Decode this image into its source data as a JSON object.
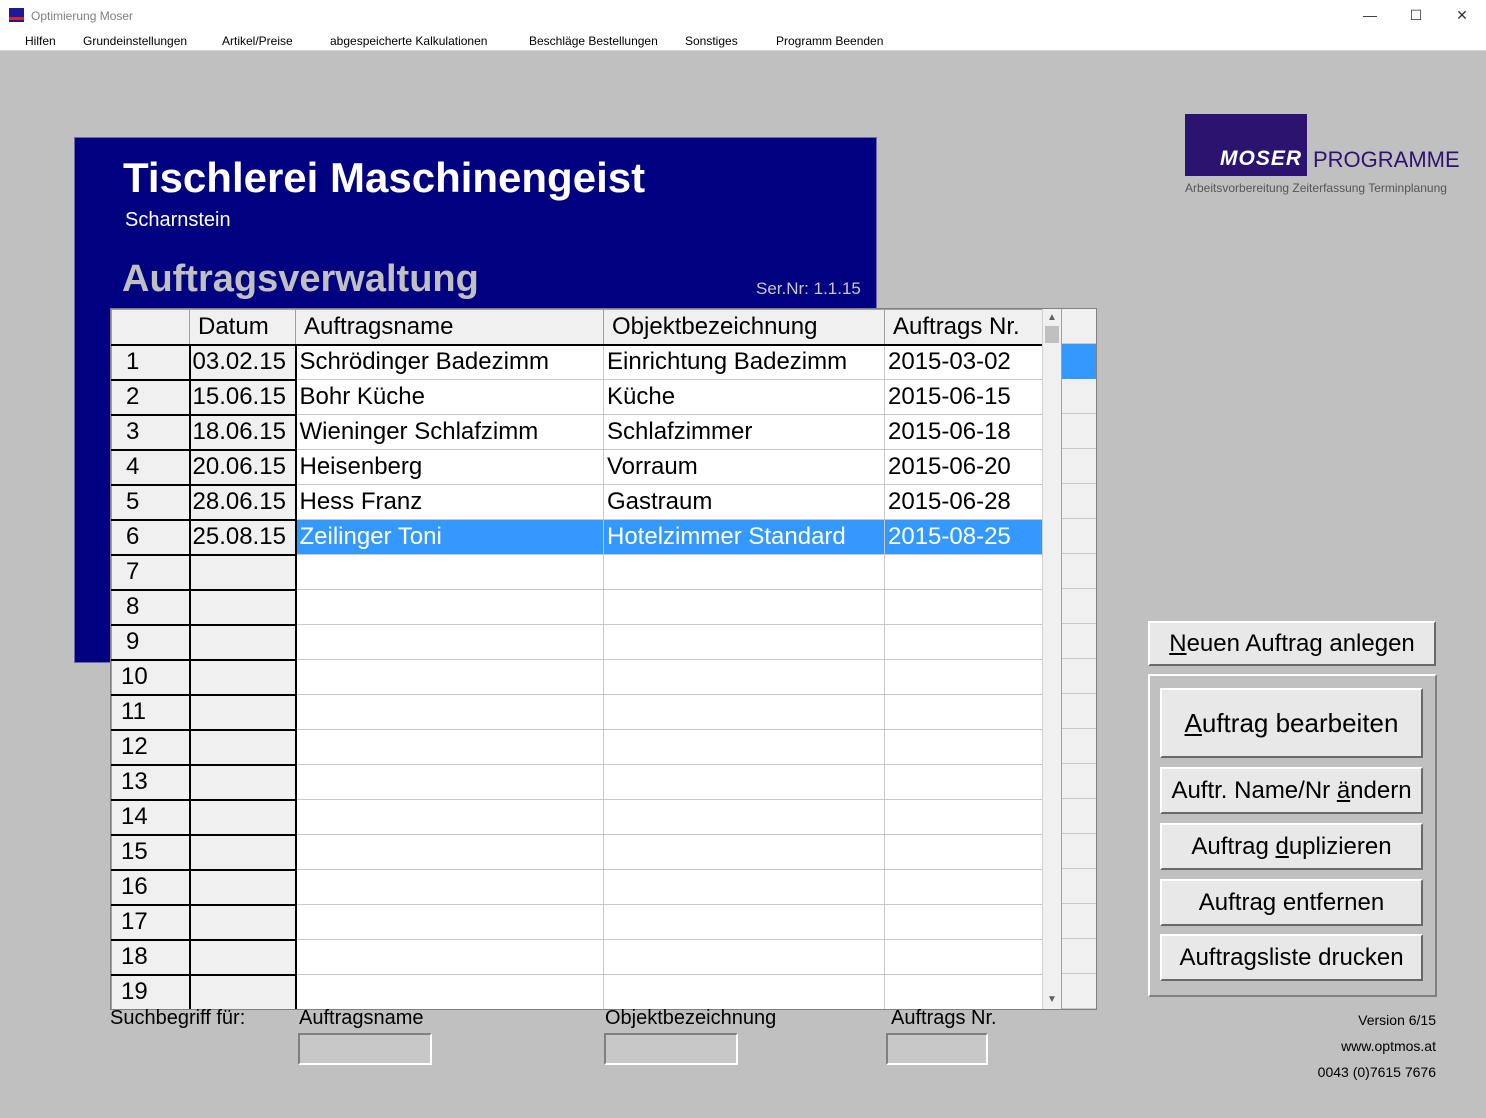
{
  "window": {
    "title": "Optimierung Moser"
  },
  "menu": [
    "Hilfen",
    "Grundeinstellungen",
    "Artikel/Preise",
    "abgespeicherte Kalkulationen",
    "Beschläge Bestellungen",
    "Sonstiges",
    "Programm Beenden"
  ],
  "header": {
    "company": "Tischlerei Maschinengeist",
    "city": "Scharnstein",
    "module": "Auftragsverwaltung",
    "serial": "Ser.Nr: 1.1.15"
  },
  "logo": {
    "word": "MOSER",
    "programme": "PROGRAMME",
    "tagline": "Arbeitsvorbereitung Zeiterfassung Terminplanung"
  },
  "grid": {
    "columns": [
      "",
      "Datum",
      "Auftragsname",
      "Objektbezeichnung",
      "Auftrags Nr."
    ],
    "selected_row": 6,
    "rows": [
      {
        "nr": "1",
        "datum": "03.02.15",
        "name": "Schrödinger Badezimm",
        "objekt": "Einrichtung Badezimm",
        "auftragsnr": "2015-03-02"
      },
      {
        "nr": "2",
        "datum": "15.06.15",
        "name": "Bohr Küche",
        "objekt": "Küche",
        "auftragsnr": "2015-06-15"
      },
      {
        "nr": "3",
        "datum": "18.06.15",
        "name": "Wieninger Schlafzimm",
        "objekt": "Schlafzimmer",
        "auftragsnr": "2015-06-18"
      },
      {
        "nr": "4",
        "datum": "20.06.15",
        "name": "Heisenberg",
        "objekt": "Vorraum",
        "auftragsnr": "2015-06-20"
      },
      {
        "nr": "5",
        "datum": "28.06.15",
        "name": "Hess Franz",
        "objekt": "Gastraum",
        "auftragsnr": "2015-06-28"
      },
      {
        "nr": "6",
        "datum": "25.08.15",
        "name": "Zeilinger Toni",
        "objekt": "Hotelzimmer Standard",
        "auftragsnr": "2015-08-25"
      },
      {
        "nr": "7",
        "datum": "",
        "name": "",
        "objekt": "",
        "auftragsnr": ""
      },
      {
        "nr": "8",
        "datum": "",
        "name": "",
        "objekt": "",
        "auftragsnr": ""
      },
      {
        "nr": "9",
        "datum": "",
        "name": "",
        "objekt": "",
        "auftragsnr": ""
      },
      {
        "nr": "10",
        "datum": "",
        "name": "",
        "objekt": "",
        "auftragsnr": ""
      },
      {
        "nr": "11",
        "datum": "",
        "name": "",
        "objekt": "",
        "auftragsnr": ""
      },
      {
        "nr": "12",
        "datum": "",
        "name": "",
        "objekt": "",
        "auftragsnr": ""
      },
      {
        "nr": "13",
        "datum": "",
        "name": "",
        "objekt": "",
        "auftragsnr": ""
      },
      {
        "nr": "14",
        "datum": "",
        "name": "",
        "objekt": "",
        "auftragsnr": ""
      },
      {
        "nr": "15",
        "datum": "",
        "name": "",
        "objekt": "",
        "auftragsnr": ""
      },
      {
        "nr": "16",
        "datum": "",
        "name": "",
        "objekt": "",
        "auftragsnr": ""
      },
      {
        "nr": "17",
        "datum": "",
        "name": "",
        "objekt": "",
        "auftragsnr": ""
      },
      {
        "nr": "18",
        "datum": "",
        "name": "",
        "objekt": "",
        "auftragsnr": ""
      },
      {
        "nr": "19",
        "datum": "",
        "name": "",
        "objekt": "",
        "auftragsnr": ""
      }
    ]
  },
  "buttons": {
    "neu": {
      "pre": "",
      "key": "N",
      "post": "euen Auftrag anlegen"
    },
    "bearbeiten": {
      "pre": "",
      "key": "A",
      "post": "uftrag bearbeiten"
    },
    "aendern": {
      "pre": "Auftr. Name/Nr ",
      "key": "ä",
      "post": "ndern"
    },
    "duplizieren": {
      "pre": "Auftrag ",
      "key": "d",
      "post": "uplizieren"
    },
    "entfernen": {
      "pre": "Auftrag entfernen",
      "key": "",
      "post": ""
    },
    "drucken": {
      "pre": "Auftragsliste drucken",
      "key": "",
      "post": ""
    }
  },
  "search": {
    "label": "Suchbegriff für:",
    "fields": [
      {
        "label": "Auftragsname",
        "value": ""
      },
      {
        "label": "Objektbezeichnung",
        "value": ""
      },
      {
        "label": "Auftrags Nr.",
        "value": ""
      }
    ]
  },
  "info": {
    "version": "Version 6/15",
    "website": "www.optmos.at",
    "phone": "0043 (0)7615 7676"
  },
  "colors": {
    "header_bg": "#000080",
    "selection": "#3399ff",
    "background": "#c0c0c0",
    "logo": "#2b1470"
  }
}
